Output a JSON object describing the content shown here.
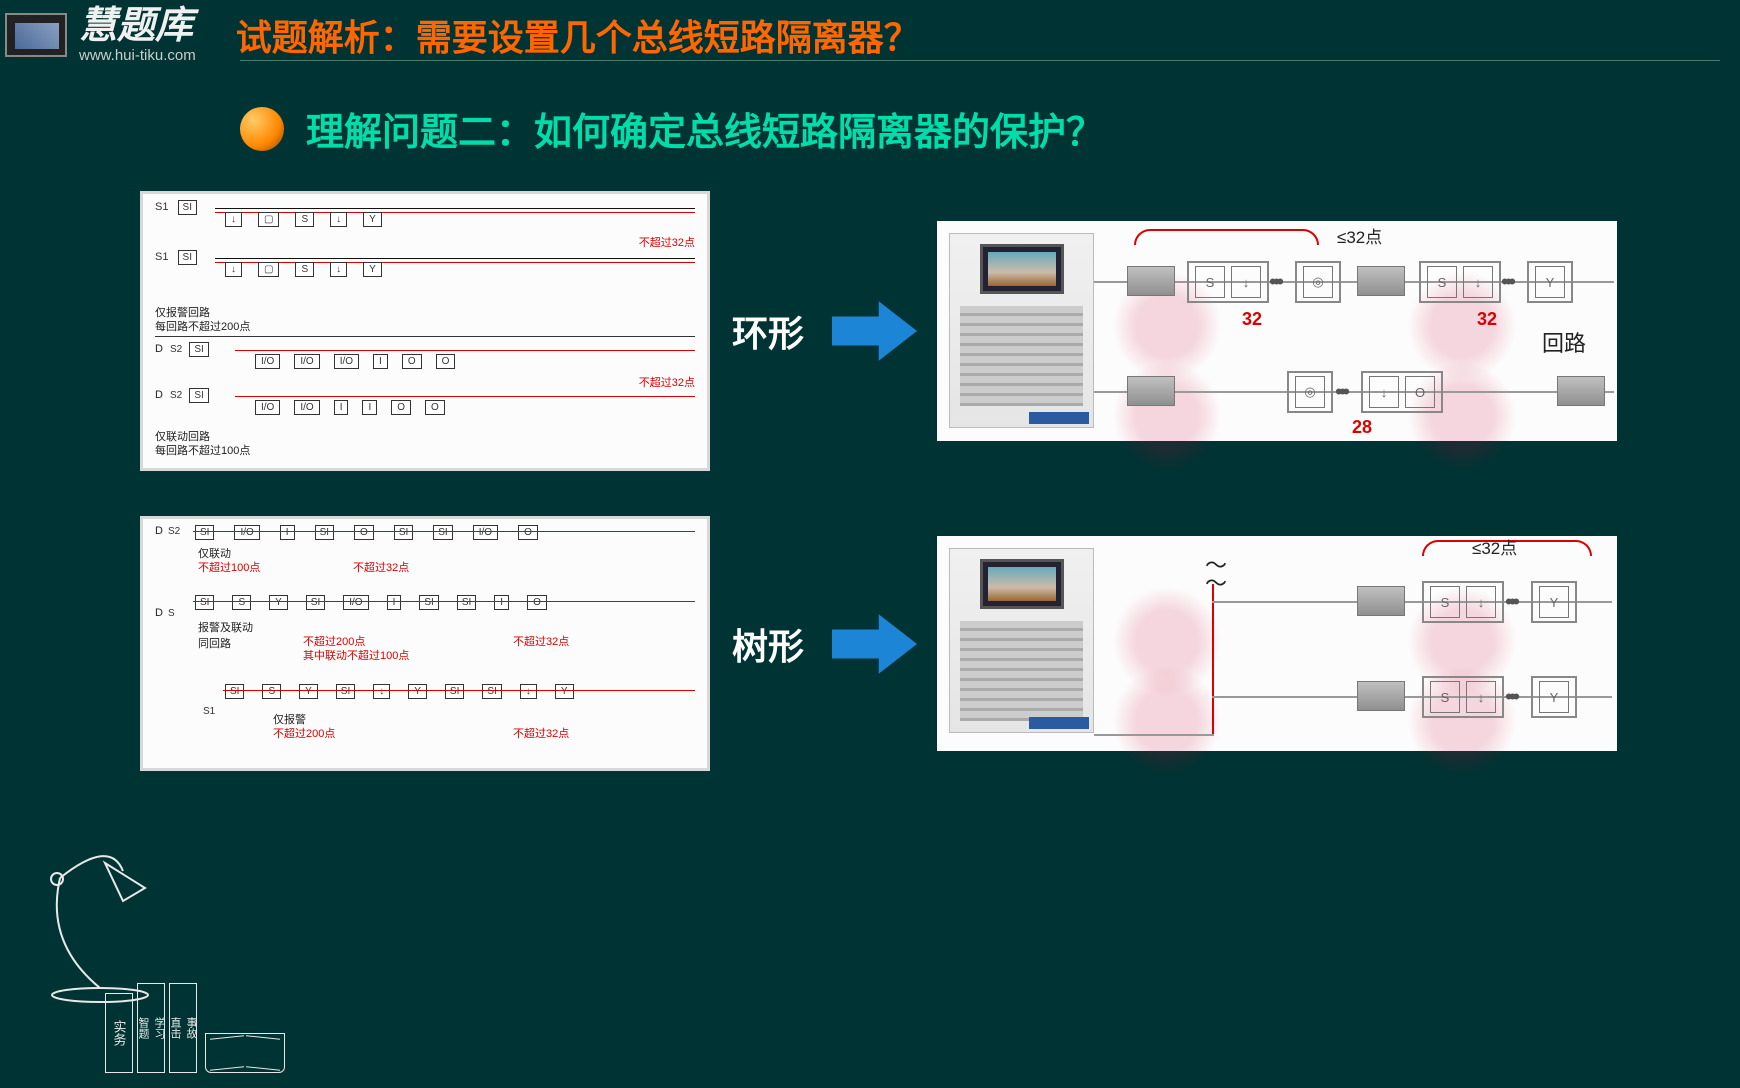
{
  "brand": {
    "name": "慧题库",
    "url": "www.hui-tiku.com"
  },
  "title": {
    "prefix": "试题解析：",
    "main": "需要设置几个总线短路隔离器",
    "qmark": "？"
  },
  "subtitle": {
    "prefix": "理解问题二：",
    "main": "如何确定总线短路隔离器的保护？"
  },
  "rows": {
    "ring": {
      "label": "环形",
      "left": {
        "line_s1a": "S1",
        "line_s1b": "S1",
        "si": "SI",
        "limit32": "不超过32点",
        "note1": "仅报警回路",
        "note1b": "每回路不超过200点",
        "s2a": "S2",
        "s2b": "S2",
        "d": "D",
        "note2": "仅联动回路",
        "note2b": "每回路不超过100点",
        "io": "I/O",
        "i_": "I",
        "o_": "O",
        "sym_s": "S",
        "sym_l": "↓",
        "sym_y": "Y",
        "sym_sq": "▢"
      },
      "right": {
        "lte32": "≤32点",
        "n32a": "32",
        "n32b": "32",
        "n28": "28",
        "huilu": "回路"
      }
    },
    "tree": {
      "label": "树形",
      "left": {
        "si": "SI",
        "io": "I/O",
        "i_": "I",
        "o_": "O",
        "d": "D",
        "s": "S",
        "s1": "S1",
        "s2": "S2",
        "limit32": "不超过32点",
        "limit200": "不超过200点",
        "limit100": "不超过100点",
        "lianlimit100": "其中联动不超过100点",
        "note1": "仅联动",
        "note2": "报警及联动\n同回路",
        "note3": "仅报警",
        "sym_s": "S",
        "sym_l": "↓",
        "sym_y": "Y"
      },
      "right": {
        "lte32": "≤32点"
      }
    }
  },
  "books": {
    "b1": "实务",
    "b2a": "智题",
    "b2b": "学习",
    "b3a": "直击",
    "b3b": "事故"
  }
}
